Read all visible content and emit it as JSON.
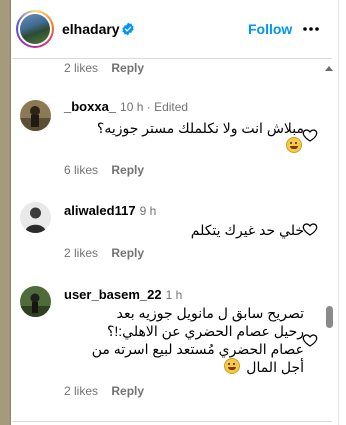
{
  "post": {
    "username": "elhadary",
    "verified": true,
    "follow_label": "Follow"
  },
  "top_meta": {
    "likes": "2 likes",
    "reply": "Reply"
  },
  "comments": [
    {
      "username": "_boxxa_",
      "time": "10 h · Edited",
      "text": "مبلاش انت ولا نكلملك مستر جوزيه؟",
      "likes": "6 likes",
      "reply": "Reply"
    },
    {
      "username": "aliwaled117",
      "time": "9 h",
      "text": "خلي حد غيرك يتكلم",
      "likes": "2 likes",
      "reply": "Reply"
    },
    {
      "username": "user_basem_22",
      "time": "1 h",
      "text_lines": [
        "تصريح سابق ل مانويل جوزيه بعد",
        "رحيل عصام الحضري عن الاهلي:!؟",
        "عصام الحضري مُستعد لبيع اسرته من",
        "أجل المال"
      ],
      "likes": "2 likes",
      "reply": "Reply"
    }
  ],
  "icons": {
    "verified": "verified-badge-icon",
    "more": "more-options-icon",
    "heart": "heart-outline-icon",
    "emoji": "grinning-face-emoji"
  },
  "colors": {
    "link_blue": "#0095f6",
    "muted": "#737373",
    "divider": "#dbdbdb"
  }
}
